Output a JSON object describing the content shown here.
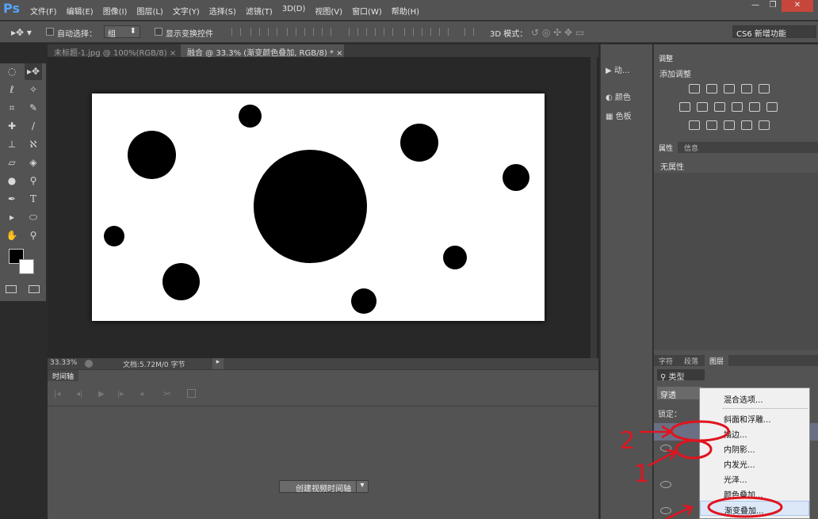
{
  "app": {
    "logo": "Ps"
  },
  "menu": [
    "文件(F)",
    "编辑(E)",
    "图像(I)",
    "图层(L)",
    "文字(Y)",
    "选择(S)",
    "滤镜(T)",
    "3D(D)",
    "视图(V)",
    "窗口(W)",
    "帮助(H)"
  ],
  "window_controls": {
    "minimize": "—",
    "restore": "❐",
    "close": "✕"
  },
  "options": {
    "auto_select_label": "自动选择：",
    "auto_select_value": "组",
    "show_transform_label": "显示变换控件",
    "mode_3d_label": "3D 模式：",
    "workspace": "CS6 新增功能"
  },
  "tabs": [
    {
      "label": "未标题-1.jpg @ 100%(RGB/8)",
      "close": "×"
    },
    {
      "label": "融合 @ 33.3% (渐变颜色叠加, RGB/8) *",
      "close": "×"
    }
  ],
  "status": {
    "zoom": "33.33%",
    "doc": "文档:5.72M/0 字节"
  },
  "timeline": {
    "title": "时间轴",
    "create_button": "创建视频时间轴"
  },
  "narrow_panel": {
    "actions": "动...",
    "color": "颜色",
    "swatches": "色板"
  },
  "adjustments": {
    "tab": "调整",
    "title": "添加调整"
  },
  "properties": {
    "tabs": [
      "属性",
      "信息"
    ],
    "empty": "无属性"
  },
  "layers": {
    "tabs": [
      "字符",
      "段落",
      "图层"
    ],
    "filter_label": "类型",
    "blend_mode": "穿透",
    "lock_label": "锁定："
  },
  "context_menu": [
    "混合选项...",
    "斜面和浮雕...",
    "描边...",
    "内阴影...",
    "内发光...",
    "光泽...",
    "颜色叠加...",
    "渐变叠加..."
  ],
  "annotations": [
    "1",
    "2"
  ],
  "colors": {
    "annotation": "#e0141e",
    "brand": "#54a4ff"
  }
}
